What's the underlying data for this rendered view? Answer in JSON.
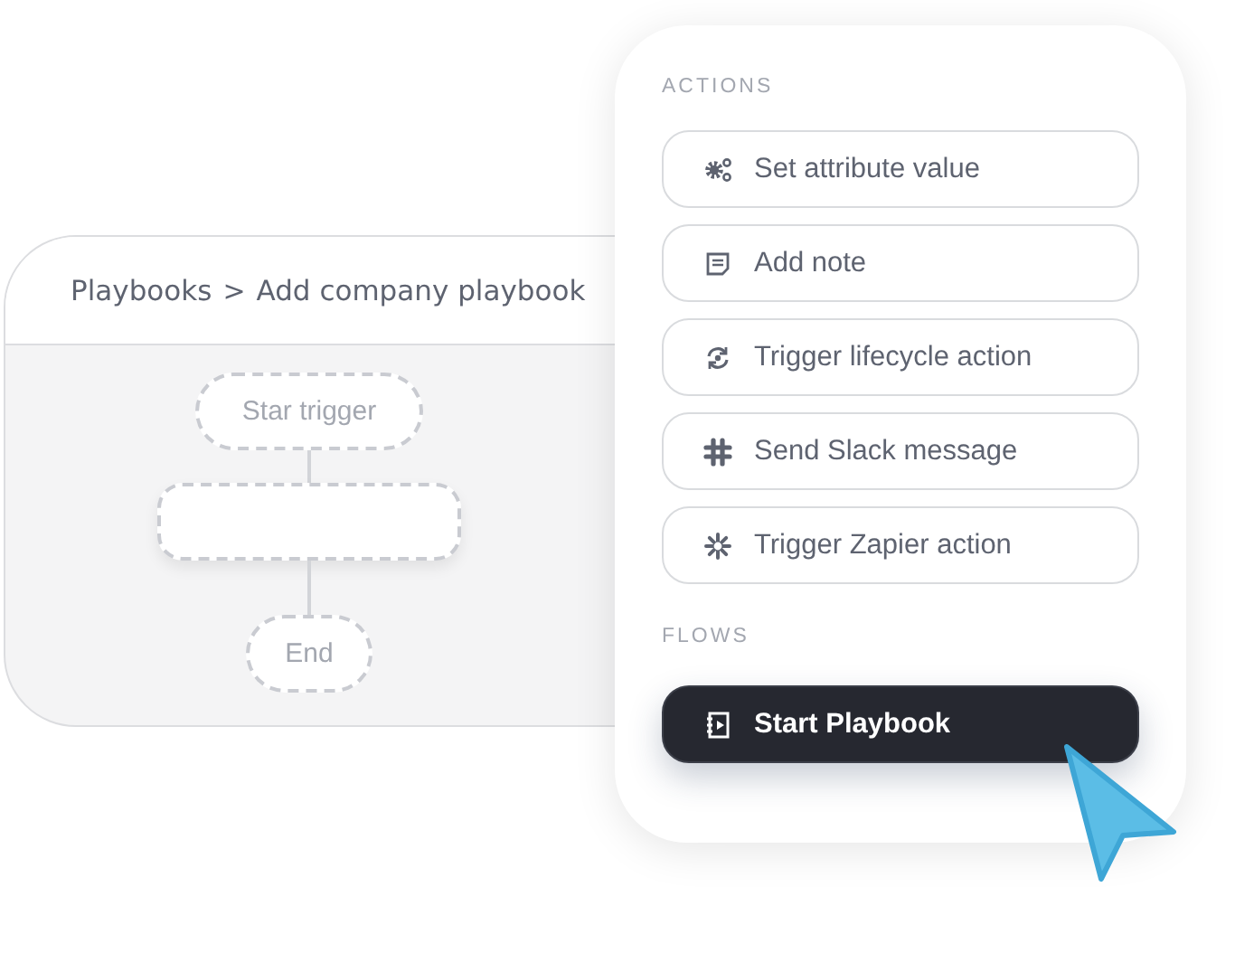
{
  "editor": {
    "breadcrumb": [
      {
        "label": "Playbooks"
      },
      {
        "label": "Add company playbook"
      }
    ],
    "separator": ">",
    "nodes": [
      {
        "kind": "trigger",
        "label": "Star trigger"
      },
      {
        "kind": "empty"
      },
      {
        "kind": "end",
        "label": "End"
      }
    ]
  },
  "panel": {
    "sections": [
      {
        "title": "ACTIONS",
        "items": [
          {
            "kind": "gears",
            "label": "Set attribute value",
            "selected": false
          },
          {
            "kind": "note",
            "label": "Add note",
            "selected": false
          },
          {
            "kind": "cycle",
            "label": "Trigger lifecycle action",
            "selected": false
          },
          {
            "kind": "slack",
            "label": "Send Slack message",
            "selected": false
          },
          {
            "kind": "asterisk",
            "label": "Trigger Zapier action",
            "selected": false
          }
        ]
      },
      {
        "title": "FLOWS",
        "items": [
          {
            "kind": "playbook",
            "label": "Start Playbook",
            "selected": true
          }
        ]
      }
    ]
  }
}
